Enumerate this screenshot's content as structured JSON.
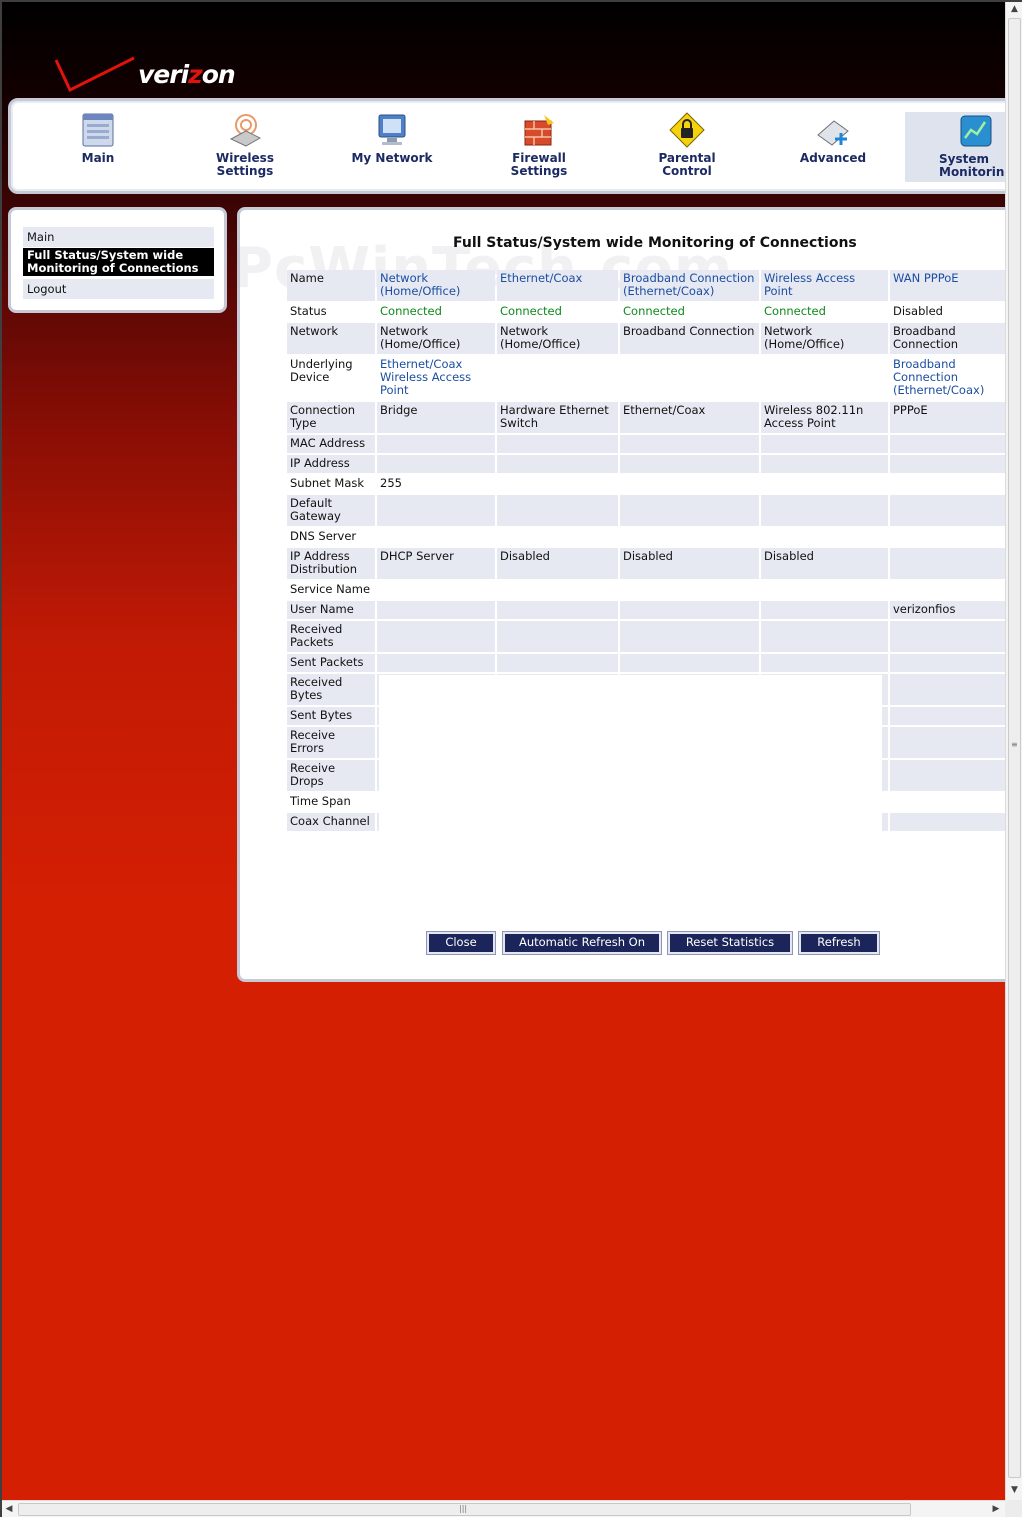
{
  "brand": {
    "logo_text_a": "veri",
    "logo_text_z": "z",
    "logo_text_b": "on",
    "accent": "#e0140c"
  },
  "nav": {
    "items": [
      {
        "label": "Main",
        "icon": "main-window-icon"
      },
      {
        "label": "Wireless\nSettings",
        "icon": "wireless-router-icon"
      },
      {
        "label": "My Network",
        "icon": "network-computers-icon"
      },
      {
        "label": "Firewall\nSettings",
        "icon": "firewall-icon"
      },
      {
        "label": "Parental\nControl",
        "icon": "padlock-warning-icon"
      },
      {
        "label": "Advanced",
        "icon": "advanced-settings-icon"
      },
      {
        "label": "System\nMonitoring",
        "icon": "system-monitor-icon"
      }
    ],
    "active_index": 6
  },
  "sidebar": {
    "items": [
      "Main",
      "Full Status/System wide Monitoring of Connections",
      "Logout"
    ],
    "active_index": 1
  },
  "page": {
    "title": "Full Status/System wide Monitoring of Connections",
    "watermark": "PcWinTech.com"
  },
  "table": {
    "rows": [
      {
        "label": "Name",
        "cells": [
          "Network (Home/Office)",
          "Ethernet/Coax",
          "Broadband Connection (Ethernet/Coax)",
          "Wireless Access Point",
          "WAN PPPoE"
        ],
        "style": [
          "blue",
          "blue",
          "blue",
          "blue",
          "blue"
        ]
      },
      {
        "label": "Status",
        "cells": [
          "Connected",
          "Connected",
          "Connected",
          "Connected",
          "Disabled"
        ],
        "style": [
          "green",
          "green",
          "green",
          "green",
          ""
        ]
      },
      {
        "label": "Network",
        "cells": [
          "Network (Home/Office)",
          "Network (Home/Office)",
          "Broadband Connection",
          "Network (Home/Office)",
          "Broadband Connection"
        ],
        "style": [
          "",
          "",
          "",
          "",
          ""
        ]
      },
      {
        "label": "Underlying Device",
        "cells": [
          "Ethernet/Coax Wireless Access Point",
          "",
          "",
          "",
          "Broadband Connection (Ethernet/Coax)"
        ],
        "style": [
          "blue",
          "",
          "",
          "",
          "blue"
        ]
      },
      {
        "label": "Connection Type",
        "cells": [
          "Bridge",
          "Hardware Ethernet Switch",
          "Ethernet/Coax",
          "Wireless 802.11n Access Point",
          "PPPoE"
        ],
        "style": [
          "",
          "",
          "",
          "",
          ""
        ]
      },
      {
        "label": "MAC Address",
        "cells": [
          "",
          "",
          "",
          "",
          ""
        ],
        "style": [
          "",
          "",
          "",
          "",
          ""
        ]
      },
      {
        "label": "IP Address",
        "cells": [
          "",
          "",
          "",
          "",
          ""
        ],
        "style": [
          "",
          "",
          "",
          "",
          ""
        ]
      },
      {
        "label": "Subnet Mask",
        "cells": [
          "255",
          "",
          "",
          "",
          ""
        ],
        "style": [
          "",
          "",
          "",
          "",
          ""
        ]
      },
      {
        "label": "Default Gateway",
        "cells": [
          "",
          "",
          "",
          "",
          ""
        ],
        "style": [
          "",
          "",
          "",
          "",
          ""
        ]
      },
      {
        "label": "DNS Server",
        "cells": [
          "",
          "",
          "",
          "",
          ""
        ],
        "style": [
          "",
          "",
          "",
          "",
          ""
        ]
      },
      {
        "label": "IP Address Distribution",
        "cells": [
          "DHCP Server",
          "Disabled",
          "Disabled",
          "Disabled",
          ""
        ],
        "style": [
          "",
          "",
          "",
          "",
          ""
        ],
        "label_style": "blue"
      },
      {
        "label": "Service Name",
        "cells": [
          "",
          "",
          "",
          "",
          ""
        ],
        "style": [
          "",
          "",
          "",
          "",
          ""
        ]
      },
      {
        "label": "User Name",
        "cells": [
          "",
          "",
          "",
          "",
          "verizonfios"
        ],
        "style": [
          "",
          "",
          "",
          "",
          ""
        ]
      },
      {
        "label": "Received Packets",
        "cells": [
          "",
          "",
          "",
          "",
          ""
        ],
        "style": [
          "",
          "",
          "",
          "",
          ""
        ]
      },
      {
        "label": "Sent Packets",
        "cells": [
          "",
          "",
          "",
          "",
          ""
        ],
        "style": [
          "",
          "",
          "",
          "",
          ""
        ]
      },
      {
        "label": "Received Bytes",
        "cells": [
          "",
          "",
          "",
          "",
          ""
        ],
        "style": [
          "",
          "",
          "",
          "",
          ""
        ]
      },
      {
        "label": "Sent Bytes",
        "cells": [
          "",
          "",
          "",
          "",
          ""
        ],
        "style": [
          "",
          "",
          "",
          "",
          ""
        ]
      },
      {
        "label": "Receive Errors",
        "cells": [
          "",
          "",
          "",
          "",
          ""
        ],
        "style": [
          "",
          "",
          "",
          "",
          ""
        ]
      },
      {
        "label": "Receive Drops",
        "cells": [
          "",
          "",
          "",
          "",
          ""
        ],
        "style": [
          "",
          "",
          "",
          "",
          ""
        ]
      },
      {
        "label": "Time Span",
        "cells": [
          "",
          "",
          "",
          "",
          ""
        ],
        "style": [
          "",
          "",
          "",
          "",
          ""
        ]
      },
      {
        "label": "Coax Channel",
        "cells": [
          "",
          "",
          "",
          "",
          ""
        ],
        "style": [
          "",
          "",
          "",
          "",
          ""
        ]
      }
    ]
  },
  "buttons": {
    "close": "Close",
    "auto_refresh": "Automatic Refresh On",
    "reset_stats": "Reset Statistics",
    "refresh": "Refresh"
  },
  "scrollbar": {
    "arrow_up": "▲",
    "arrow_down": "▼",
    "arrow_left": "◀",
    "arrow_right": "▶",
    "grip": "≡",
    "grip_h": "|||"
  }
}
